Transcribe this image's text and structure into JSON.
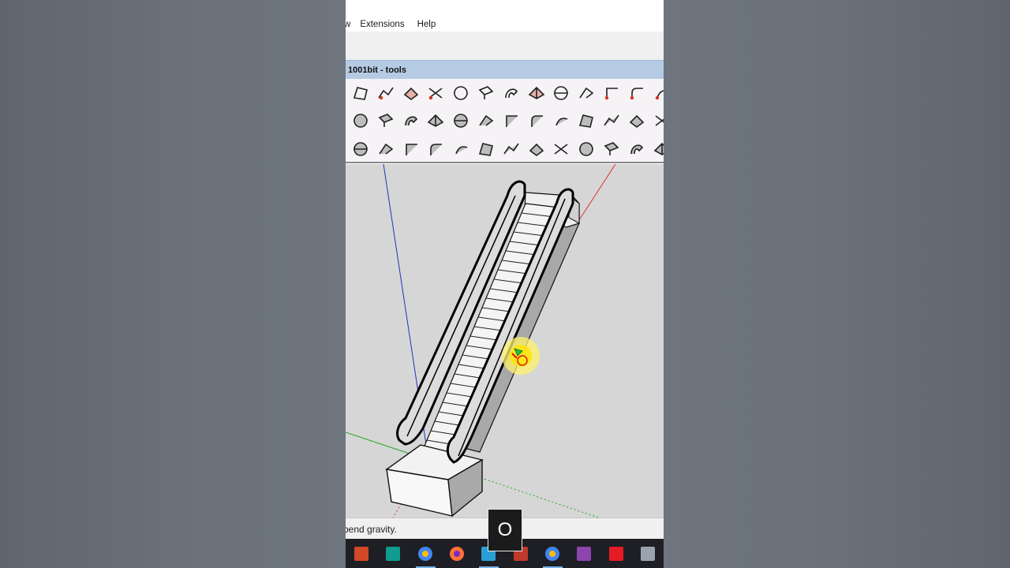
{
  "menu": {
    "cut_item": "w",
    "items": [
      "Extensions",
      "Help"
    ]
  },
  "toolbar": {
    "title": "1001bit - tools",
    "rows": [
      [
        "polygon-tool-icon",
        "polyline-tool-icon",
        "fill-face-tool-icon",
        "divide-line-tool-icon",
        "circle-points-tool-icon",
        "extrude-face-tool-icon",
        "bend-tool-icon",
        "roof-tool-icon",
        "sphere-tool-icon",
        "fold-tool-icon",
        "corner-tool-icon",
        "fillet-tool-icon",
        "arc-red-tool-icon"
      ],
      [
        "slab-tool-icon",
        "wall-opening-tool-icon",
        "pyramid-tool-icon",
        "columns-tool-icon",
        "balusters-tool-icon",
        "cylinder-tool-icon",
        "leaf-face-tool-icon",
        "wedge-tool-icon",
        "steps-block-tool-icon",
        "ramp-tool-icon",
        "staircase-tool-icon",
        "spiral-stair-tool-icon",
        "stair-outline-tool-icon"
      ],
      [
        "spiral-ramp-tool-icon",
        "louver-tool-icon",
        "door-tool-icon",
        "window-tool-icon",
        "grid-tool-icon",
        "lattice-tool-icon",
        "framing-tool-icon",
        "joists-tool-icon",
        "rafters-tool-icon",
        "truss-tool-icon",
        "fence-tool-icon",
        "hip-roof-tool-icon",
        "gable-roof-tool-icon"
      ]
    ]
  },
  "status": {
    "text": "bend gravity."
  },
  "key_overlay": {
    "key": "O"
  },
  "taskbar": {
    "items": [
      {
        "name": "powerpoint-taskbar-icon",
        "color": "#d24726"
      },
      {
        "name": "filmora-taskbar-icon",
        "color": "#0f9b8e"
      },
      {
        "name": "chrome-taskbar-icon",
        "color": "#4285f4"
      },
      {
        "name": "firefox-taskbar-icon",
        "color": "#ff7139"
      },
      {
        "name": "media-player-taskbar-icon",
        "color": "#2a9fd6"
      },
      {
        "name": "sketchup-taskbar-icon",
        "color": "#c0392b"
      },
      {
        "name": "chrome-taskbar-icon",
        "color": "#4285f4"
      },
      {
        "name": "winrar-taskbar-icon",
        "color": "#8e44ad"
      },
      {
        "name": "autocad-taskbar-icon",
        "color": "#e51b24"
      },
      {
        "name": "network-taskbar-icon",
        "color": "#9aa3ad"
      }
    ]
  }
}
